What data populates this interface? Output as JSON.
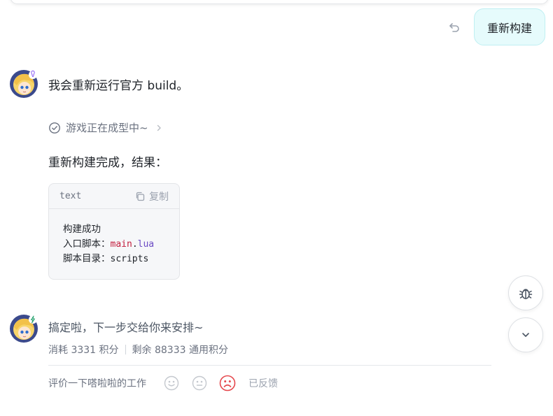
{
  "user_message": {
    "text": "重新构建"
  },
  "assistant_1": {
    "message": "我会重新运行官方 build。",
    "status": "游戏正在成型中~",
    "result_heading": "重新构建完成，结果：",
    "code_block": {
      "language": "text",
      "copy_label": "复制",
      "lines": {
        "line1": "构建成功",
        "line2_prefix": "入口脚本：",
        "line2_file": "main",
        "line2_dot": ".",
        "line2_ext": "lua",
        "line3_prefix": "脚本目录：",
        "line3_value": "scripts"
      }
    }
  },
  "assistant_2": {
    "message": "搞定啦，下一步交给你来安排~",
    "credits_used": "消耗 3331 积分",
    "credits_left": "剩余 88333 通用积分"
  },
  "rating": {
    "label": "评价一下嗒啦啦的工作",
    "feedback_status": "已反馈",
    "selected": "unhappy"
  },
  "colors": {
    "user_bubble_bg": "#e6fbfc",
    "code_keyword_red": "#c3203f",
    "code_keyword_purple": "#6b4bc4",
    "selected_face": "#e5484d"
  },
  "icons": {
    "undo": "undo-icon",
    "status": "check-circle-icon",
    "copy": "copy-icon",
    "bug": "bug-icon",
    "scroll_down": "chevron-down-icon"
  }
}
